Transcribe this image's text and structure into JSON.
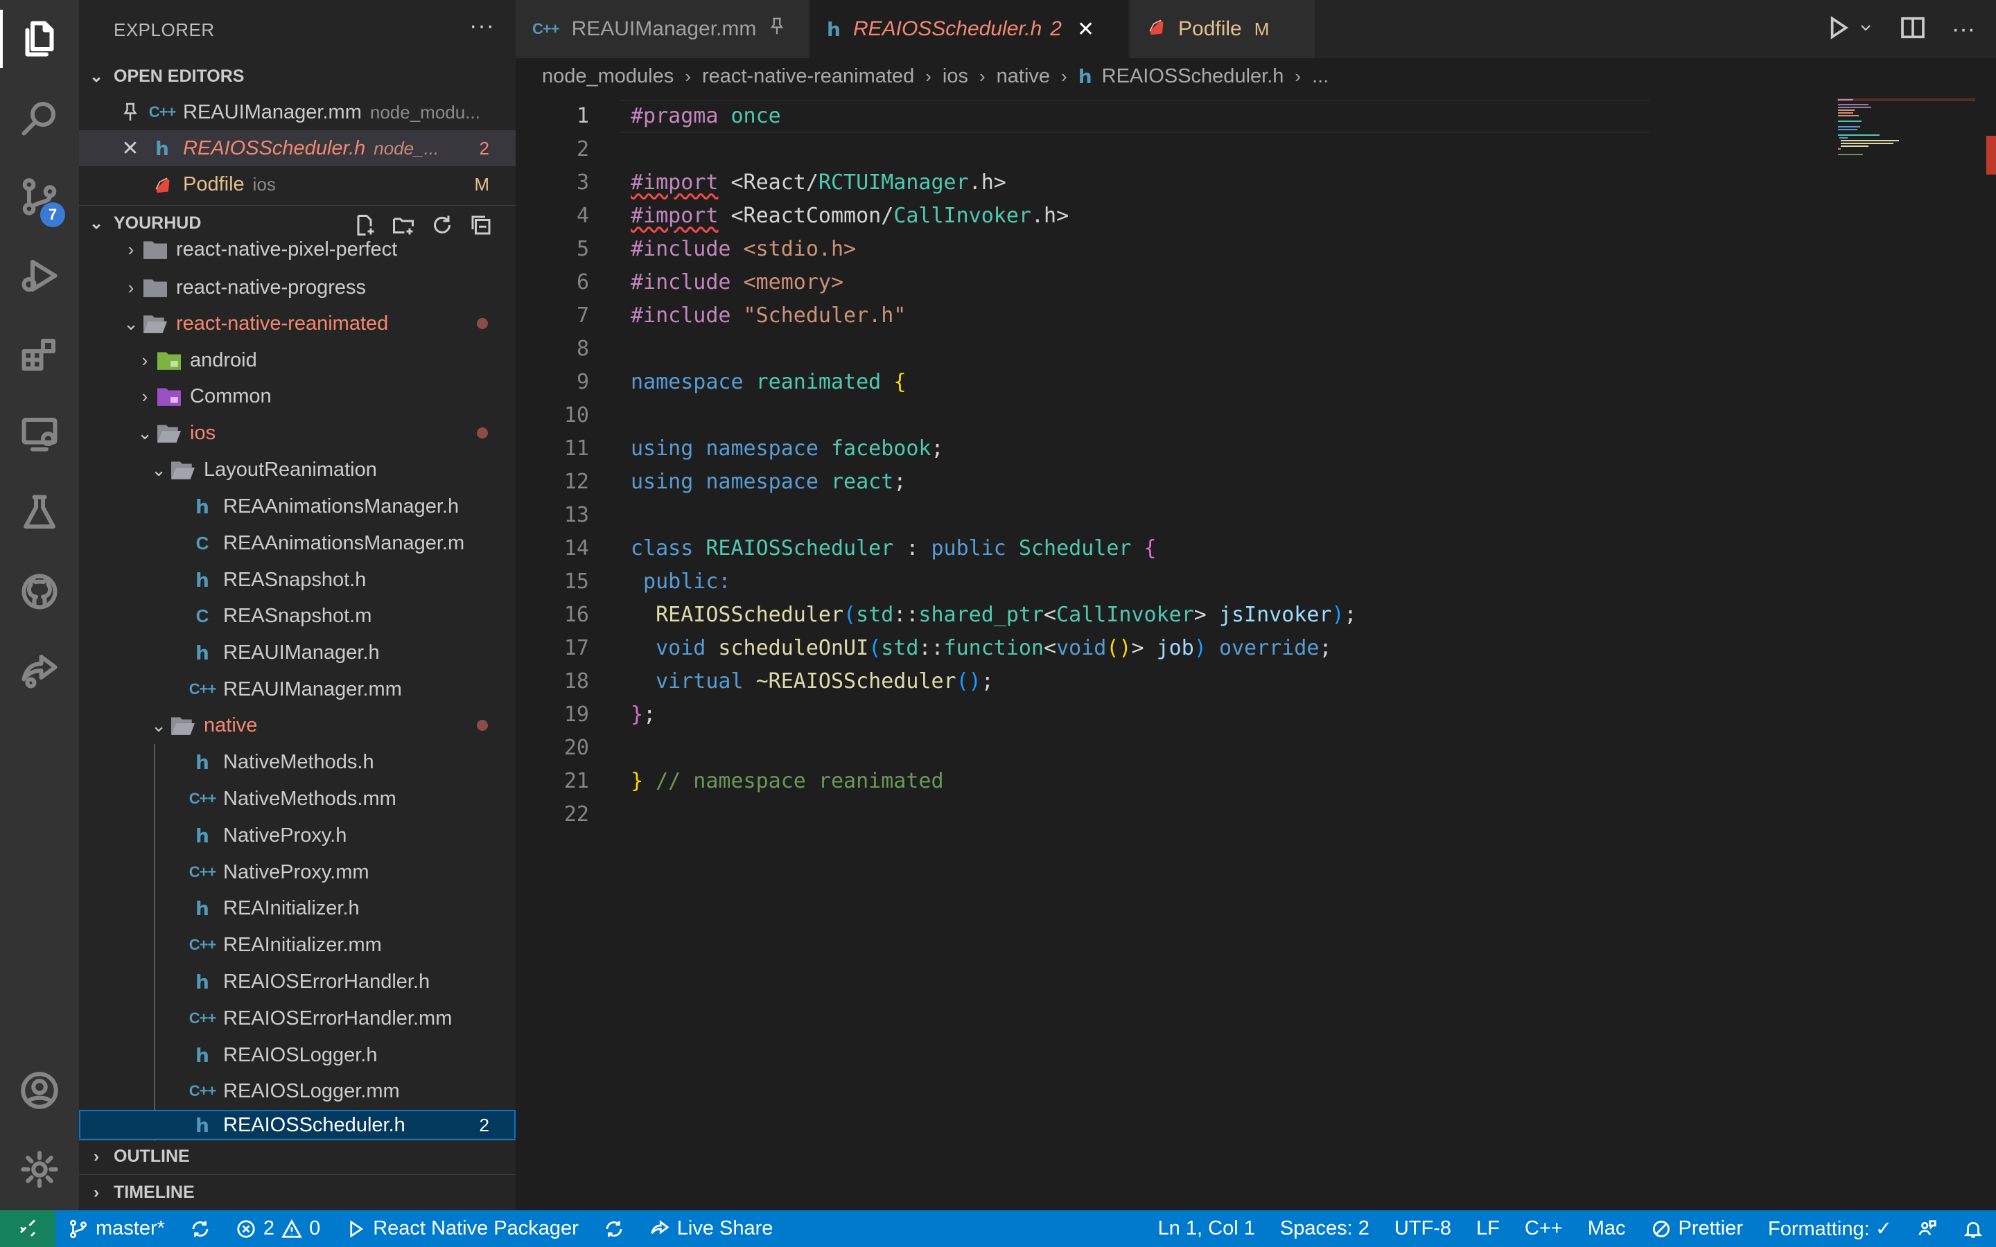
{
  "activity_bar": {
    "items": [
      "explorer-icon",
      "search-icon",
      "source-control-icon",
      "run-debug-icon",
      "extensions-icon",
      "remote-explorer-icon",
      "testing-icon",
      "github-icon",
      "live-share-icon"
    ],
    "source_control_badge": "7",
    "bottom": [
      "account-icon",
      "manage-gear-icon"
    ]
  },
  "sidebar": {
    "title": "EXPLORER",
    "open_editors": {
      "header": "OPEN EDITORS",
      "items": [
        {
          "icon": "C++",
          "name": "REAUIManager.mm",
          "desc": "node_modu...",
          "badge": ""
        },
        {
          "icon": "h",
          "name": "REAIOSScheduler.h",
          "desc": "node_...",
          "badge": "2"
        },
        {
          "icon": "ruby",
          "name": "Podfile",
          "desc": "ios",
          "badge": "M"
        }
      ]
    },
    "workspace": {
      "header": "YOURHUD",
      "items": [
        {
          "name": "react-native-pixel-perfect"
        },
        {
          "name": "react-native-progress"
        },
        {
          "name": "react-native-reanimated"
        },
        {
          "name": "android"
        },
        {
          "name": "Common"
        },
        {
          "name": "ios"
        },
        {
          "name": "LayoutReanimation"
        },
        {
          "name": "REAAnimationsManager.h",
          "icon": "h"
        },
        {
          "name": "REAAnimationsManager.m",
          "icon": "C"
        },
        {
          "name": "REASnapshot.h",
          "icon": "h"
        },
        {
          "name": "REASnapshot.m",
          "icon": "C"
        },
        {
          "name": "REAUIManager.h",
          "icon": "h"
        },
        {
          "name": "REAUIManager.mm",
          "icon": "C++"
        },
        {
          "name": "native"
        },
        {
          "name": "NativeMethods.h",
          "icon": "h"
        },
        {
          "name": "NativeMethods.mm",
          "icon": "C++"
        },
        {
          "name": "NativeProxy.h",
          "icon": "h"
        },
        {
          "name": "NativeProxy.mm",
          "icon": "C++"
        },
        {
          "name": "REAInitializer.h",
          "icon": "h"
        },
        {
          "name": "REAInitializer.mm",
          "icon": "C++"
        },
        {
          "name": "REAIOSErrorHandler.h",
          "icon": "h"
        },
        {
          "name": "REAIOSErrorHandler.mm",
          "icon": "C++"
        },
        {
          "name": "REAIOSLogger.h",
          "icon": "h"
        },
        {
          "name": "REAIOSLogger.mm",
          "icon": "C++"
        },
        {
          "name": "REAIOSScheduler.h",
          "icon": "h",
          "badge": "2"
        }
      ]
    },
    "outline": "OUTLINE",
    "timeline": "TIMELINE"
  },
  "tabs": [
    {
      "icon": "C++",
      "label": "REAUIManager.mm"
    },
    {
      "icon": "h",
      "label": "REAIOSScheduler.h",
      "badge": "2"
    },
    {
      "icon": "ruby",
      "label": "Podfile",
      "badge": "M"
    }
  ],
  "breadcrumb": [
    "node_modules",
    "react-native-reanimated",
    "ios",
    "native",
    "REAIOSScheduler.h",
    "..."
  ],
  "breadcrumb_icon": "h",
  "editor": {
    "line_numbers": [
      "1",
      "2",
      "3",
      "4",
      "5",
      "6",
      "7",
      "8",
      "9",
      "10",
      "11",
      "12",
      "13",
      "14",
      "15",
      "16",
      "17",
      "18",
      "19",
      "20",
      "21",
      "22"
    ],
    "lines": {
      "l1": [
        "#pragma",
        " once"
      ],
      "l3": [
        "#import",
        " <React/",
        "RCTUIManager",
        ".h>"
      ],
      "l4": [
        "#import",
        " <ReactCommon/",
        "CallInvoker",
        ".h>"
      ],
      "l5": [
        "#include",
        " <stdio.h>"
      ],
      "l6": [
        "#include",
        " <memory>"
      ],
      "l7": [
        "#include",
        " \"Scheduler.h\""
      ],
      "l9": [
        "namespace",
        " reanimated ",
        "{"
      ],
      "l11": [
        "using",
        " namespace",
        " facebook",
        ";"
      ],
      "l12": [
        "using",
        " namespace",
        " react",
        ";"
      ],
      "l14": [
        "class",
        " REAIOSScheduler",
        " : ",
        "public",
        " Scheduler",
        " {"
      ],
      "l15": [
        " public:"
      ],
      "l16": [
        "  REAIOSScheduler",
        "(",
        "std",
        "::",
        "shared_ptr",
        "<",
        "CallInvoker",
        "> ",
        "jsInvoker",
        ")",
        ";"
      ],
      "l17": [
        "  void",
        " scheduleOnUI",
        "(",
        "std",
        "::",
        "function",
        "<",
        "void",
        "()",
        "> ",
        "job",
        ") ",
        "override",
        ";"
      ],
      "l18": [
        "  virtual",
        " ~REAIOSScheduler",
        "()",
        ";"
      ],
      "l19": [
        "}",
        ";"
      ],
      "l21": [
        "}",
        " // namespace reanimated"
      ]
    }
  },
  "statusbar": {
    "branch": "master*",
    "errors": "2",
    "warnings": "0",
    "packager": "React Native Packager",
    "live_share": "Live Share",
    "position": "Ln 1, Col 1",
    "spaces": "Spaces: 2",
    "encoding": "UTF-8",
    "eol": "LF",
    "language": "C++",
    "platform": "Mac",
    "prettier": "Prettier",
    "formatting": "Formatting: ✓"
  },
  "colors": {
    "statusbar": "#007acc",
    "remote": "#16825d",
    "modified_file": "#e2c08d",
    "error_file": "#f48771",
    "selection": "#04395e"
  }
}
